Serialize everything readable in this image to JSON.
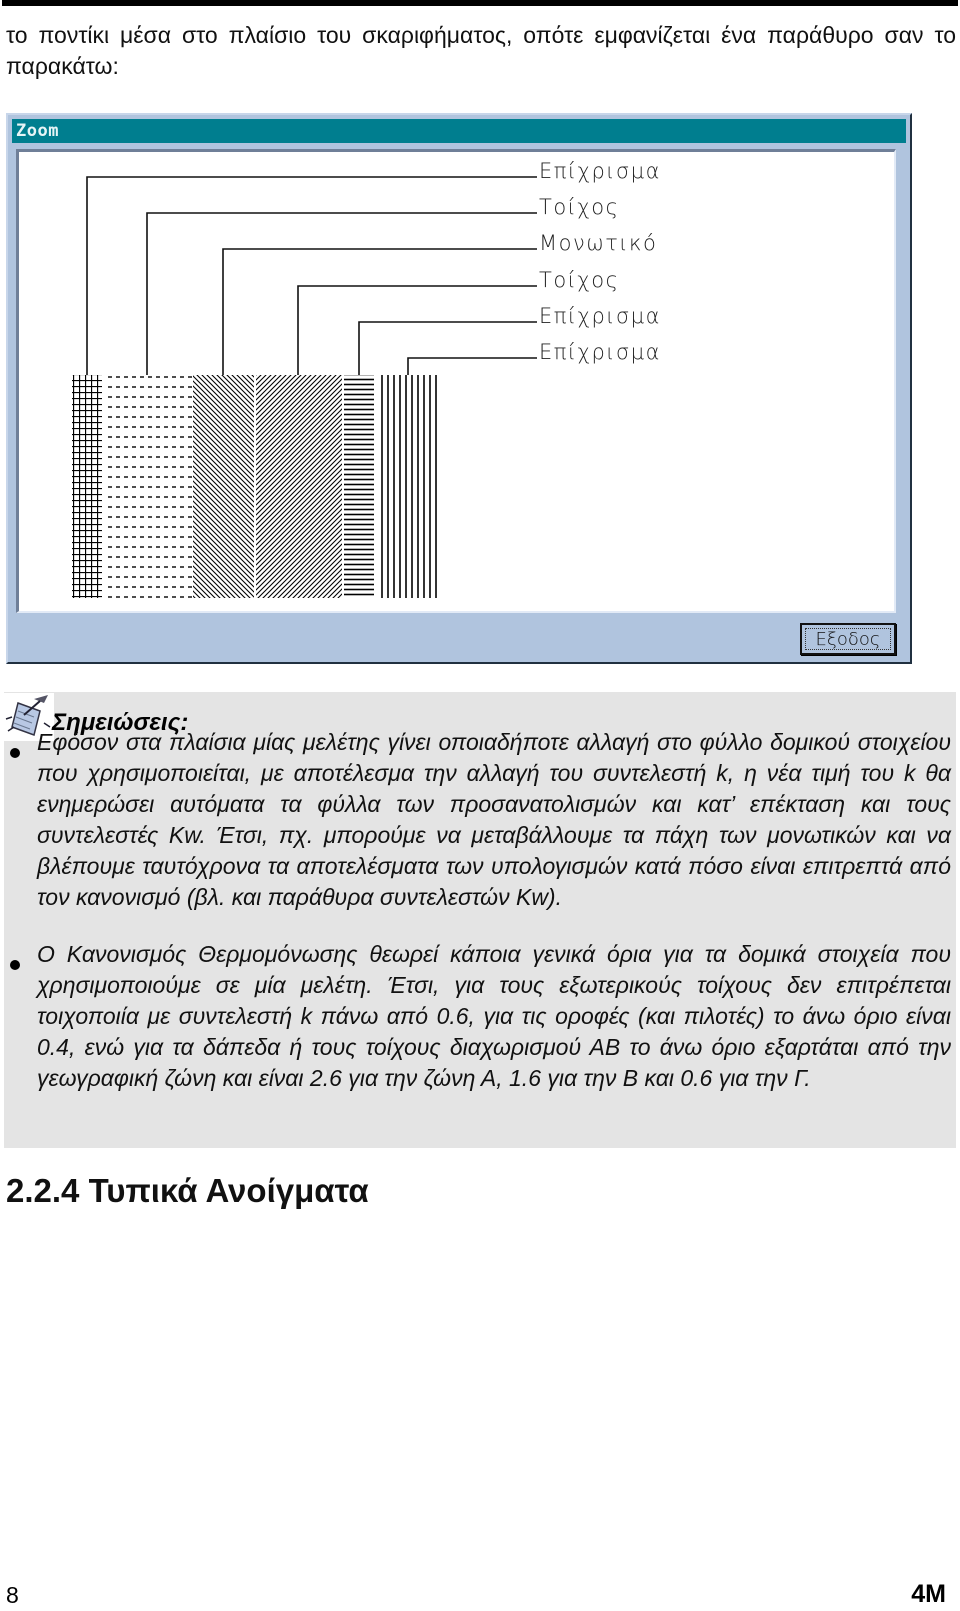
{
  "intro": {
    "text": "το ποντίκι μέσα στο πλαίσιο του σκαριφήματος, οπότε εμφανίζεται ένα παράθυρο σαν το παρακάτω:"
  },
  "dialog": {
    "title": "Zoom",
    "colors": {
      "titlebar": "#007e8f",
      "body": "#b0c4de",
      "canvas": "#ffffff"
    },
    "layers": [
      {
        "label": "Επίχρισμα",
        "pattern": "grid"
      },
      {
        "label": "Τοίχος",
        "pattern": "dashed-horizontal"
      },
      {
        "label": "Μονωτικό",
        "pattern": "diagonal-backslash"
      },
      {
        "label": "Τοίχος",
        "pattern": "diagonal-slash"
      },
      {
        "label": "Επίχρισμα",
        "pattern": "horizontal-lines"
      },
      {
        "label": "Επίχρισμα",
        "pattern": "vertical-lines"
      }
    ],
    "exit_button": "Εξοδος"
  },
  "notes": {
    "title": "Σημειώσεις:",
    "icon": "notepad-pen-icon",
    "items": [
      "Εφόσον στα πλαίσια μίας μελέτης γίνει οποιαδήποτε αλλαγή στο φύλλο δομικού στοιχείου που χρησιμοποιείται, με αποτέλεσμα την αλλαγή του συντελεστή k, η νέα τιμή του k θα ενημερώσει αυτόματα τα φύλλα των προσανατολισμών και κατ’ επέκταση και τους συντελεστές Kw. Έτσι, πχ. μπορούμε να μεταβάλλουμε τα πάχη των μονωτικών και να βλέπουμε ταυτόχρονα τα αποτελέσματα των υπολογισμών κατά πόσο είναι επιτρεπτά από τον κανονισμό (βλ. και παράθυρα συντελεστών Kw).",
      "Ο Κανονισμός Θερμομόνωσης θεωρεί κάποια γενικά όρια για τα δομικά στοιχεία που χρησιμοποιούμε σε μία μελέτη. Έτσι, για τους εξωτερικούς τοίχους δεν επιτρέπεται τοιχοποιία με συντελεστή k πάνω από 0.6, για τις οροφές (και πιλοτές) το άνω όριο είναι 0.4, ενώ για τα δάπεδα ή τους τοίχους διαχωρισμού ΑΒ το άνω όριο εξαρτάται από την γεωγραφική ζώνη και είναι 2.6 για την ζώνη Α, 1.6 για την Β και 0.6 για την Γ."
    ]
  },
  "section_heading": "2.2.4 Τυπικά Ανοίγματα",
  "footer": {
    "page_number": "8",
    "brand": "4M"
  }
}
